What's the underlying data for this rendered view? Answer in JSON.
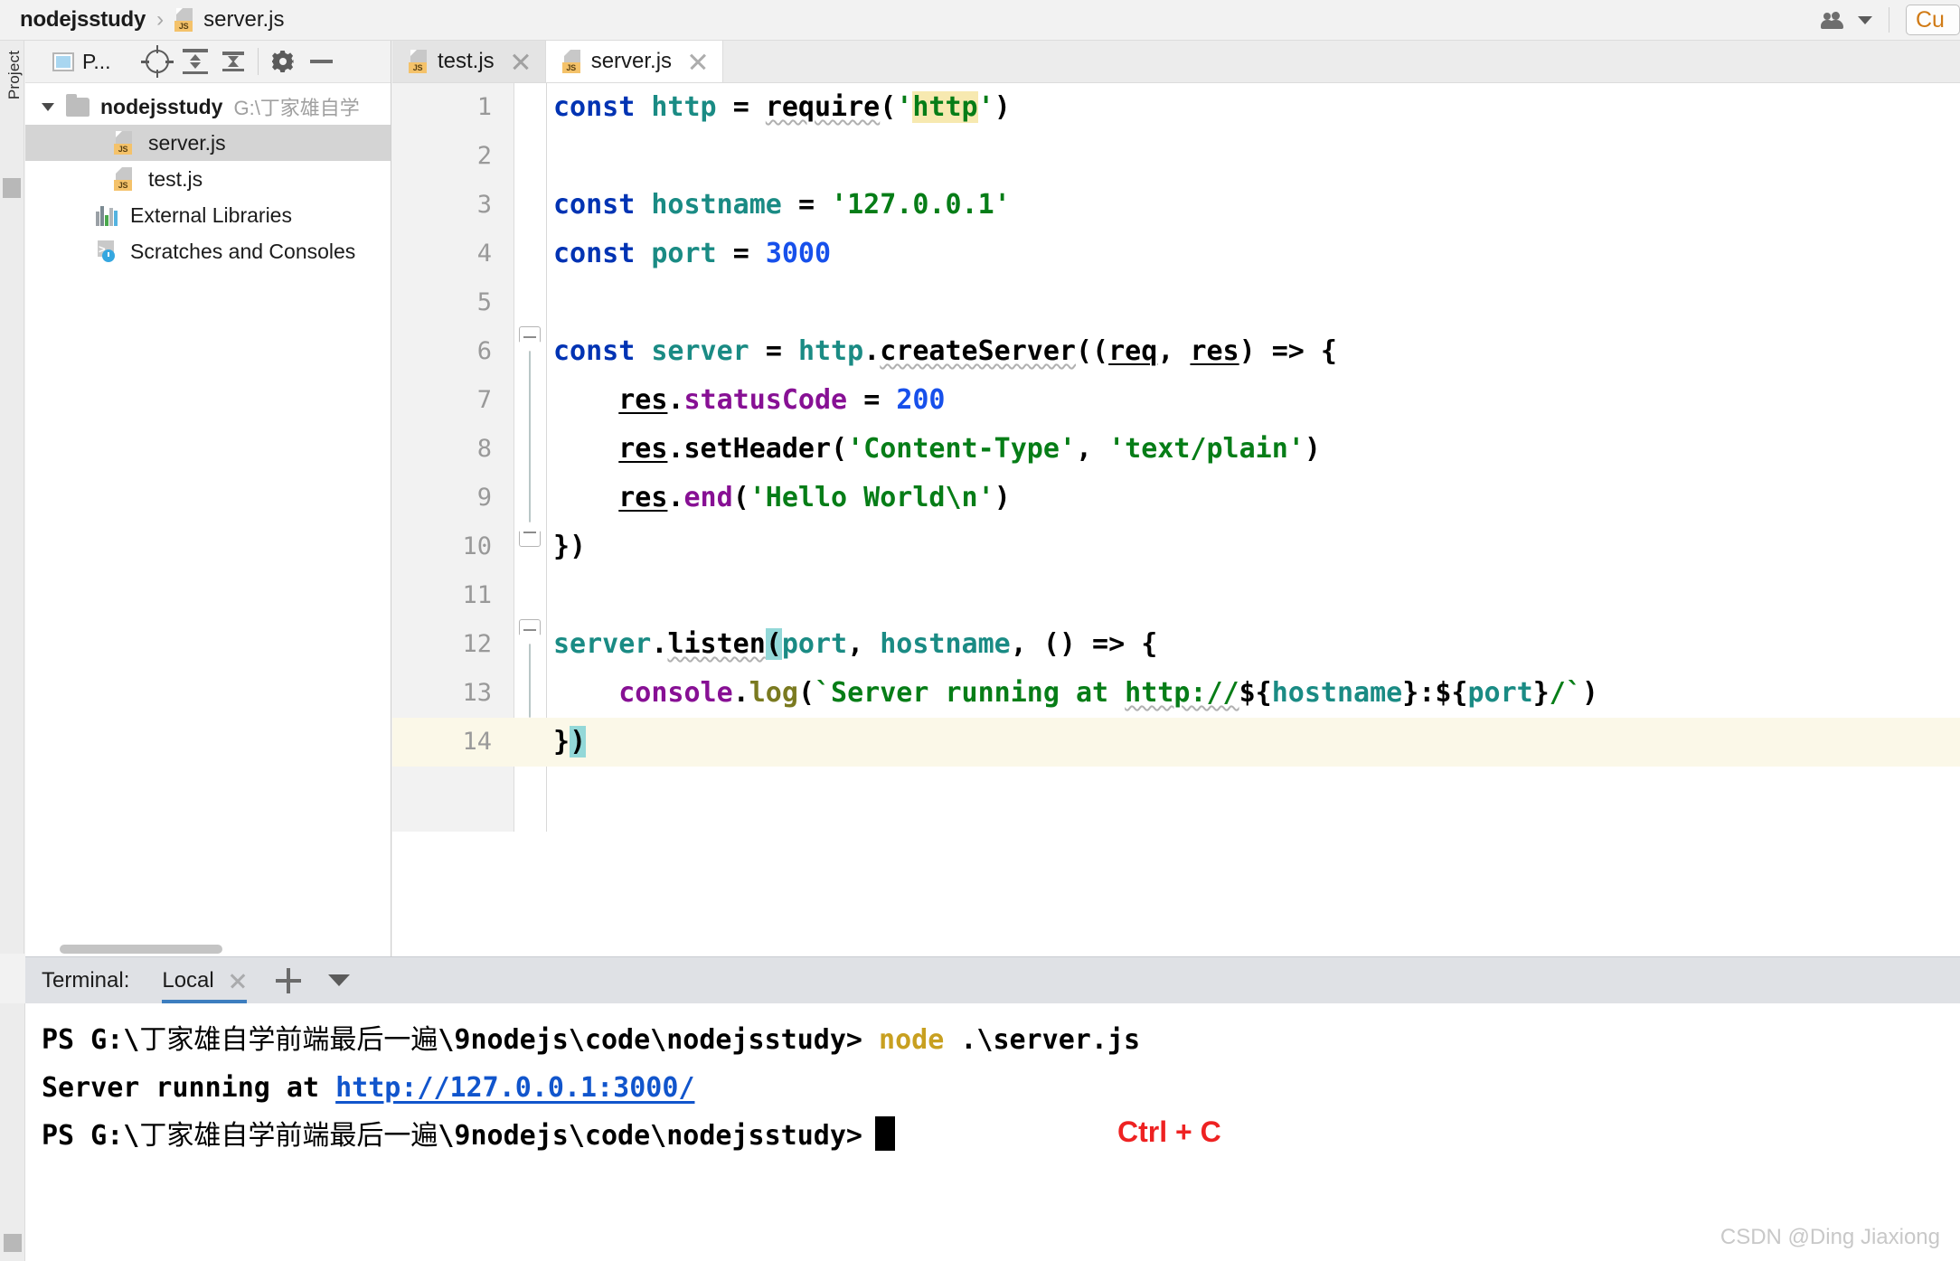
{
  "window": {
    "breadcrumb": {
      "project": "nodejsstudy",
      "separator": "›",
      "file": "server.js"
    },
    "run_config_label": "Cu",
    "people_icon": "people-icon",
    "caret_icon": "chevron-down-icon"
  },
  "project_panel": {
    "tool_window_label": "Project",
    "title": "P...",
    "toolbar": [
      {
        "name": "select-opened-file-button",
        "icon": "target-icon"
      },
      {
        "name": "expand-all-button",
        "icon": "expand-all-icon"
      },
      {
        "name": "collapse-all-button",
        "icon": "collapse-all-icon"
      },
      {
        "name": "settings-button",
        "icon": "gear-icon"
      },
      {
        "name": "hide-button",
        "icon": "minus-icon"
      }
    ],
    "tree": [
      {
        "label": "nodejsstudy",
        "path": "G:\\丁家雄自学",
        "type": "folder",
        "expanded": true,
        "selected": false
      },
      {
        "label": "server.js",
        "type": "js-file",
        "selected": true
      },
      {
        "label": "test.js",
        "type": "js-file",
        "selected": false
      },
      {
        "label": "External Libraries",
        "type": "libraries",
        "selected": false
      },
      {
        "label": "Scratches and Consoles",
        "type": "scratches",
        "selected": false
      }
    ]
  },
  "editor": {
    "tabs": [
      {
        "label": "test.js",
        "active": false,
        "icon": "js-file-icon",
        "close": "close-icon"
      },
      {
        "label": "server.js",
        "active": true,
        "icon": "js-file-icon",
        "close": "close-icon"
      }
    ],
    "current_line": 14,
    "line_numbers": [
      "1",
      "2",
      "3",
      "4",
      "5",
      "6",
      "7",
      "8",
      "9",
      "10",
      "11",
      "12",
      "13",
      "14"
    ],
    "code_lines": [
      "const http = require('http')",
      "",
      "const hostname = '127.0.0.1'",
      "const port = 3000",
      "",
      "const server = http.createServer((req, res) => {",
      "    res.statusCode = 200",
      "    res.setHeader('Content-Type', 'text/plain')",
      "    res.end('Hello World\\n')",
      "})",
      "",
      "server.listen(port, hostname, () => {",
      "    console.log(`Server running at http://${hostname}:${port}/`)",
      "})"
    ]
  },
  "terminal": {
    "label": "Terminal:",
    "tab": "Local",
    "close_icon": "close-icon",
    "add_icon": "plus-icon",
    "options_icon": "chevron-down-icon",
    "lines": [
      {
        "prompt": "PS G:\\",
        "cn_path": "丁家雄自学前端最后一遍",
        "rest": "\\9nodejs\\code\\nodejsstudy>",
        "command": "node",
        "args": ".\\server.js"
      },
      {
        "text_prefix": "Server running at ",
        "url": "http://127.0.0.1:3000/"
      },
      {
        "prompt": "PS G:\\",
        "cn_path": "丁家雄自学前端最后一遍",
        "rest": "\\9nodejs\\code\\nodejsstudy>",
        "cursor": true,
        "annotation": "Ctrl + C"
      }
    ]
  },
  "watermark": "CSDN @Ding Jiaxiong",
  "colors": {
    "keyword": "#0033b3",
    "identifier": "#1a8b84",
    "string": "#067d17",
    "number": "#1750eb",
    "console": "#871094",
    "method": "#7a7a20",
    "search_highlight": "#f7e9b0",
    "bracket_highlight": "#93d8d8",
    "caret_row": "#fbf8e8",
    "terminal_command": "#c8a020",
    "terminal_link": "#1155cc",
    "annotation_red": "#ee2222",
    "tab_underline": "#3d7ebf"
  }
}
